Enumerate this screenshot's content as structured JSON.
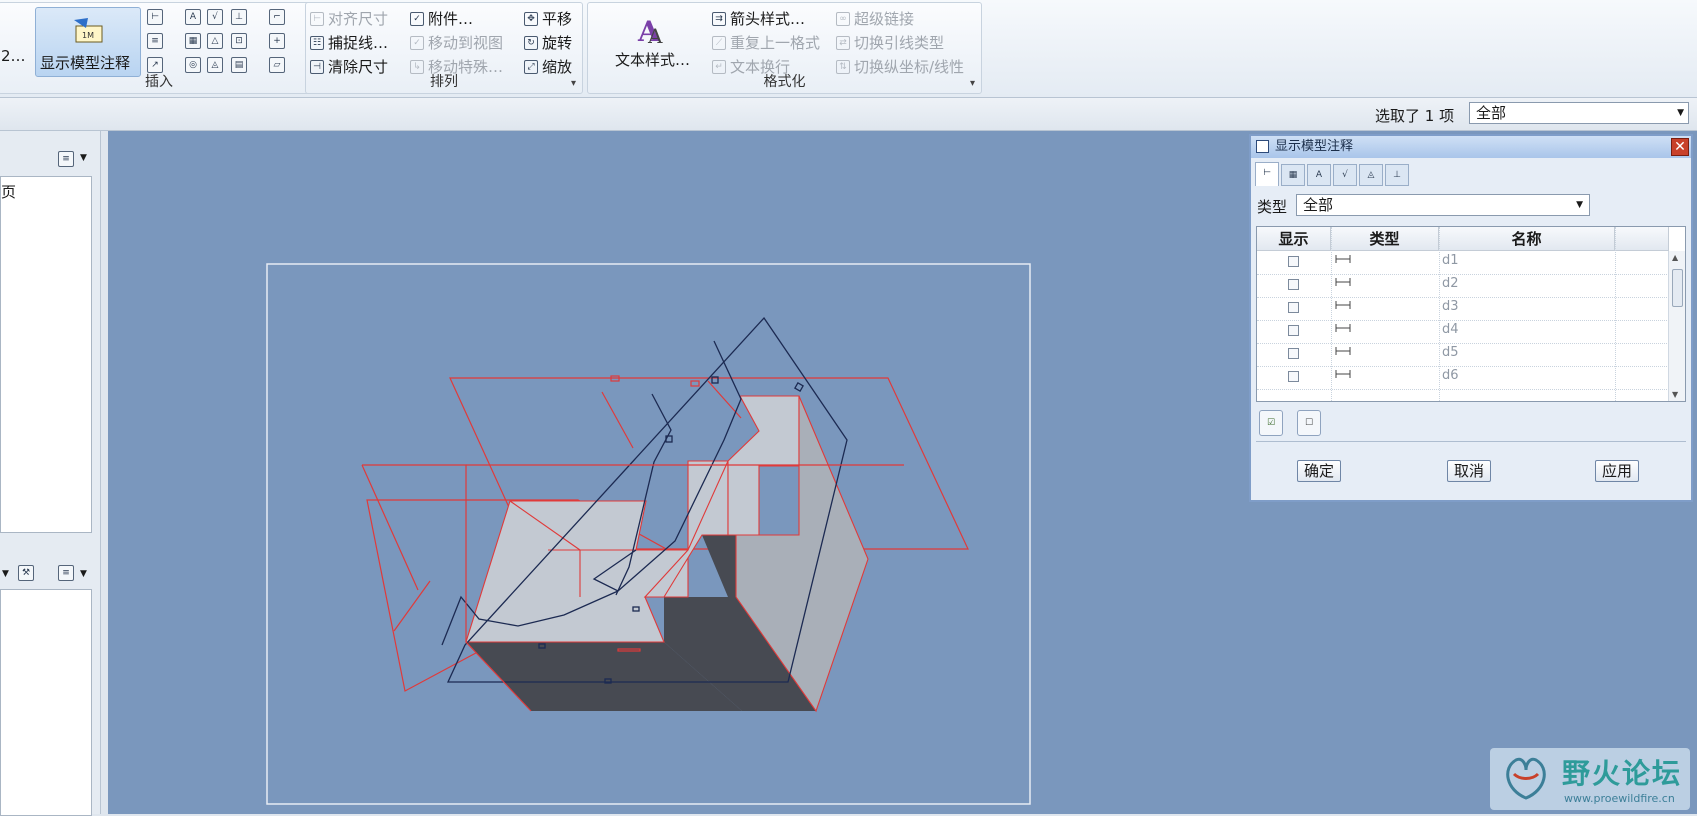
{
  "ribbon": {
    "insert": {
      "big_button": "显示模型注释",
      "title": "插入",
      "cut_text": "2…"
    },
    "arrange": {
      "title": "排列",
      "items": {
        "align_dim": "对齐尺寸",
        "attach": "附件…",
        "pan": "平移",
        "snap_line": "捕捉线…",
        "move_to_view": "移动到视图",
        "rotate": "旋转",
        "clear_dim": "清除尺寸",
        "move_special": "移动特殊…",
        "zoom": "缩放"
      }
    },
    "format": {
      "title": "格式化",
      "text_style": "文本样式…",
      "arrow_style": "箭头样式…",
      "repeat_format": "重复上一格式",
      "text_wrap": "文本换行",
      "hyperlink": "超级链接",
      "toggle_leader": "切换引线类型",
      "toggle_ordinate": "切换纵坐标/线性"
    }
  },
  "selection": {
    "prefix": "选取了",
    "count": "1",
    "suffix": "项",
    "filter": "全部"
  },
  "left_panel": {
    "fragment": "页"
  },
  "dialog": {
    "title": "显示模型注释",
    "type_label": "类型",
    "type_value": "全部",
    "columns": [
      "显示",
      "类型",
      "名称"
    ],
    "rows": [
      {
        "name": "d1",
        "checked": false
      },
      {
        "name": "d2",
        "checked": false
      },
      {
        "name": "d3",
        "checked": false
      },
      {
        "name": "d4",
        "checked": false
      },
      {
        "name": "d5",
        "checked": false
      },
      {
        "name": "d6",
        "checked": false
      }
    ],
    "buttons": {
      "ok": "确定",
      "cancel": "取消",
      "apply": "应用"
    }
  },
  "watermark": {
    "text": "野火论坛",
    "url": "www.proewildfire.cn"
  },
  "colors": {
    "canvas": "#7a97bd",
    "model_light": "#c3c9d2",
    "model_dark": "#474a52",
    "datum_red": "#e03a3a",
    "edge_navy": "#1c2a52"
  }
}
